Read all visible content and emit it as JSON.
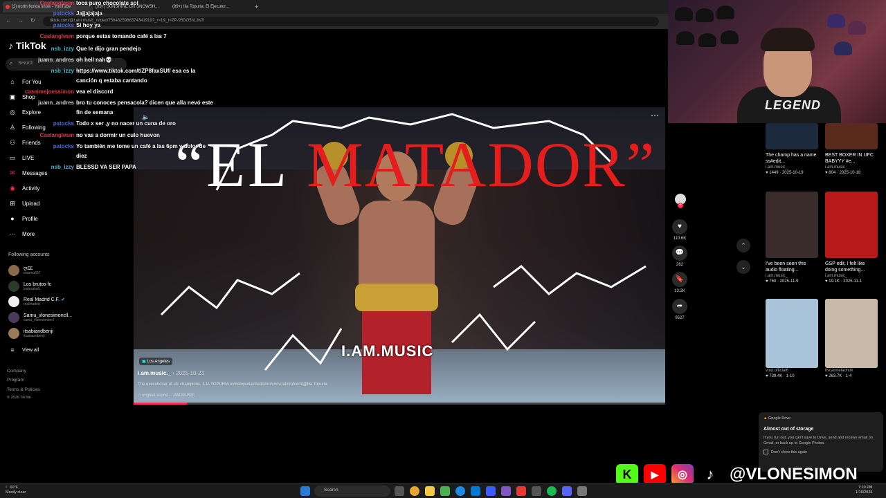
{
  "browser": {
    "tabs": [
      {
        "label": "(2) north florida snow - YouTube"
      },
      {
        "label": "(99+) SUNSHINE OR SNOWSH..."
      },
      {
        "label": "(99+) Ilia Topuria: El Ejecutor..."
      }
    ],
    "url": "tiktok.com/@i.am.music_/video/7564325966374341919?_r=1&_t=ZP-93DO5h1Jw7i"
  },
  "sidebar": {
    "logo": "TikTok",
    "search_placeholder": "Search",
    "nav": [
      {
        "label": "For You",
        "icon": "home-icon"
      },
      {
        "label": "Shop",
        "icon": "shop-icon"
      },
      {
        "label": "Explore",
        "icon": "compass-icon"
      },
      {
        "label": "Following",
        "icon": "following-icon"
      },
      {
        "label": "Friends",
        "icon": "friends-icon"
      },
      {
        "label": "LIVE",
        "icon": "live-icon"
      },
      {
        "label": "Messages",
        "icon": "messages-icon"
      },
      {
        "label": "Activity",
        "icon": "activity-icon"
      },
      {
        "label": "Upload",
        "icon": "upload-icon"
      },
      {
        "label": "Profile",
        "icon": "profile-icon"
      },
      {
        "label": "More",
        "icon": "more-icon"
      }
    ],
    "following_heading": "Following accounts",
    "accounts": [
      {
        "name": "ღ££",
        "handle": "elsamu697"
      },
      {
        "name": "Los brutos fc",
        "handle": "losbrutosfc"
      },
      {
        "name": "Real Madrid C.F.",
        "handle": "realmadrid"
      },
      {
        "name": "Samu_vlonesimoncll...",
        "handle": "samu_vlonesimoncl"
      },
      {
        "name": "itsabiandbenji",
        "handle": "itsabiandbenji"
      }
    ],
    "view_all": "View all",
    "footer": [
      "Company",
      "Program",
      "Terms & Policies",
      "© 2026 TikTok"
    ]
  },
  "chat": [
    {
      "user": "Caslanglesm",
      "color": "#e0364b",
      "msg": "toca puro chocolate sol"
    },
    {
      "user": "patocks",
      "color": "#4a6bd8",
      "msg": "Jajjajajaja"
    },
    {
      "user": "patocks",
      "color": "#4a6bd8",
      "msg": "Si hoy ya"
    },
    {
      "user": "Caslanglesm",
      "color": "#e0364b",
      "msg": "porque estas tomando café a las 7"
    },
    {
      "user": "nsb_izzy",
      "color": "#40b7c9",
      "msg": "Que le dijo gran pendejo"
    },
    {
      "user": "juann_andres",
      "color": "#c8c8c8",
      "msg": "oh hell nah💀"
    },
    {
      "user": "nsb_izzy",
      "color": "#40b7c9",
      "msg": "https://www.tiktok.com/t/ZP8faxSUf/ esa es la"
    },
    {
      "user": "",
      "color": "#ffffff",
      "msg": "canción q estaba cantando"
    },
    {
      "user": "caseimejoessimon",
      "color": "#e0364b",
      "msg": "vea el discord"
    },
    {
      "user": "juann_andres",
      "color": "#c8c8c8",
      "msg": "bro tu conoces pensacola? dicen que alla nevó este"
    },
    {
      "user": "",
      "color": "#ffffff",
      "msg": "fin de semana"
    },
    {
      "user": "patocks",
      "color": "#4a6bd8",
      "msg": "Todo x ser ,y no nacer un cuna de oro"
    },
    {
      "user": "Caslanglesm",
      "color": "#e0364b",
      "msg": "no vas a dormir un culo huevon"
    },
    {
      "user": "patocks",
      "color": "#4a6bd8",
      "msg": "Yo también me tome un café a las 6pm y dolor de"
    },
    {
      "user": "",
      "color": "#ffffff",
      "msg": "diez"
    },
    {
      "user": "nsb_izzy",
      "color": "#40b7c9",
      "msg": "BLESSD VA SER PAPA"
    }
  ],
  "video": {
    "title_left": "“EL",
    "title_right": "MATADOR”",
    "watermark": "I.AM.MUSIC",
    "location": "Los Angeles",
    "author": "i.am.music._",
    "date": "2025-10-23",
    "description": "The executioner of ufc champions, ILIA TOPURIA ##iliatopuria##edit##ufc##viral##ufcedit@Ilia Topuria",
    "sound": "original sound - I.AM.MUSIC",
    "progress": 0.1
  },
  "actions": [
    {
      "icon": "heart-icon",
      "count": "110.6K"
    },
    {
      "icon": "comment-icon",
      "count": "262"
    },
    {
      "icon": "bookmark-icon",
      "count": "13.2K"
    },
    {
      "icon": "share-icon",
      "count": "9527"
    }
  ],
  "webcam_text": "LEGEND",
  "grid": [
    {
      "title": "The champ has a name ss#edit...",
      "author": "i.am.music_",
      "likes": "1449",
      "date": "2025-10-19",
      "bg": "#1d2a3d"
    },
    {
      "title": "BEST BOXER IN UFC BABYYY #e...",
      "author": "i.am.music_",
      "likes": "804",
      "date": "2025-10-18",
      "bg": "#5a2a1c"
    },
    {
      "title": "I've been seen this audio floating...",
      "author": "i.am.music_",
      "likes": "760",
      "date": "2025-11-9",
      "bg": "#3a2c2a"
    },
    {
      "title": "GSP edit, I felt like doing something...",
      "author": "i.am.music_",
      "likes": "19.1K",
      "date": "2025-11-1",
      "bg": "#b81a1a"
    },
    {
      "title": "",
      "author": "void.official6",
      "likes": "739.4K",
      "date": "1-10",
      "bg": "#a9c3d8"
    },
    {
      "title": "",
      "author": "itscarmelaohok",
      "likes": "263.7K",
      "date": "1-4",
      "bg": "#c9b9a8"
    }
  ],
  "toast": {
    "app": "Google Drive",
    "title": "Almost out of storage",
    "body": "If you run out, you can't save to Drive, send and receive email on Gmail, or back up to Google Photos.",
    "checkbox": "Don't show this again"
  },
  "social": {
    "handle": "@VLONESIMON"
  },
  "taskbar": {
    "temp": "60°F",
    "weather": "Mostly clear",
    "search": "Search",
    "time": "7:10 PM",
    "date": "1/19/2026"
  }
}
